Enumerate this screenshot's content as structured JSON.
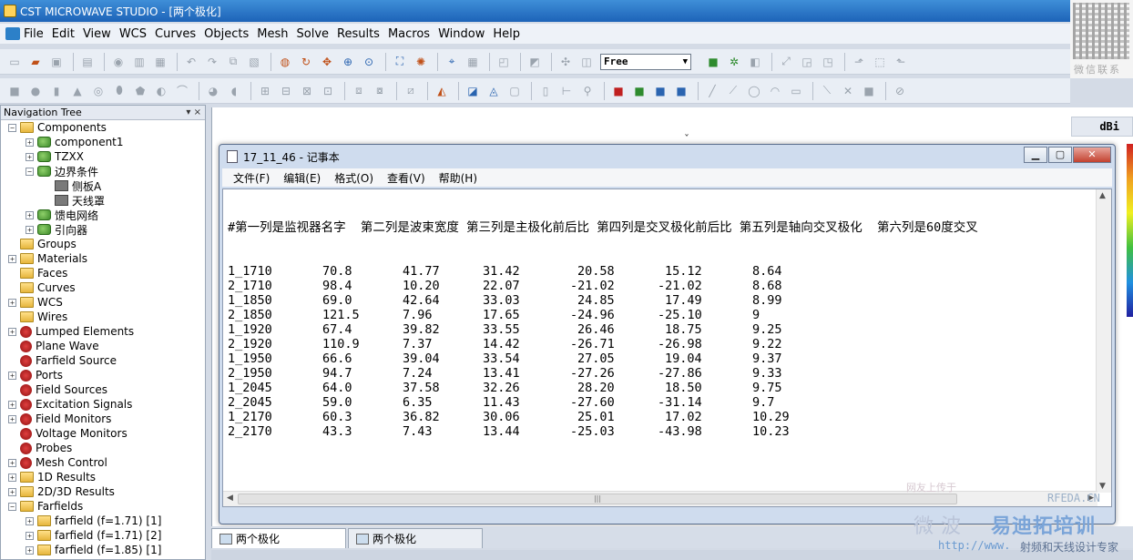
{
  "app": {
    "title": "CST MICROWAVE STUDIO - [两个极化]"
  },
  "menu": [
    "File",
    "Edit",
    "View",
    "WCS",
    "Curves",
    "Objects",
    "Mesh",
    "Solve",
    "Results",
    "Macros",
    "Window",
    "Help"
  ],
  "toolbar": {
    "mode_select": "Free"
  },
  "qr": {
    "caption": "微信联系"
  },
  "nav": {
    "title": "Navigation Tree",
    "header_icons": "▾ ×",
    "items": [
      {
        "label": "Components",
        "expander": "−",
        "icon": "folder",
        "indent": 0
      },
      {
        "label": "component1",
        "expander": "+",
        "icon": "comp",
        "indent": 1
      },
      {
        "label": "TZXX",
        "expander": "+",
        "icon": "comp",
        "indent": 1
      },
      {
        "label": "边界条件",
        "expander": "−",
        "icon": "comp",
        "indent": 1
      },
      {
        "label": "侧板A",
        "expander": "",
        "icon": "leaf",
        "indent": 2
      },
      {
        "label": "天线罩",
        "expander": "",
        "icon": "leaf",
        "indent": 2
      },
      {
        "label": "馈电网络",
        "expander": "+",
        "icon": "comp",
        "indent": 1
      },
      {
        "label": "引向器",
        "expander": "+",
        "icon": "comp",
        "indent": 1
      },
      {
        "label": "Groups",
        "expander": "",
        "icon": "folder",
        "indent": 0
      },
      {
        "label": "Materials",
        "expander": "+",
        "icon": "folder",
        "indent": 0
      },
      {
        "label": "Faces",
        "expander": "",
        "icon": "folder",
        "indent": 0
      },
      {
        "label": "Curves",
        "expander": "",
        "icon": "folder",
        "indent": 0
      },
      {
        "label": "WCS",
        "expander": "+",
        "icon": "folder",
        "indent": 0
      },
      {
        "label": "Wires",
        "expander": "",
        "icon": "folder",
        "indent": 0
      },
      {
        "label": "Lumped Elements",
        "expander": "+",
        "icon": "port",
        "indent": 0
      },
      {
        "label": "Plane Wave",
        "expander": "",
        "icon": "port",
        "indent": 0
      },
      {
        "label": "Farfield Source",
        "expander": "",
        "icon": "port",
        "indent": 0
      },
      {
        "label": "Ports",
        "expander": "+",
        "icon": "port",
        "indent": 0
      },
      {
        "label": "Field Sources",
        "expander": "",
        "icon": "port",
        "indent": 0
      },
      {
        "label": "Excitation Signals",
        "expander": "+",
        "icon": "port",
        "indent": 0
      },
      {
        "label": "Field Monitors",
        "expander": "+",
        "icon": "port",
        "indent": 0
      },
      {
        "label": "Voltage Monitors",
        "expander": "",
        "icon": "port",
        "indent": 0
      },
      {
        "label": "Probes",
        "expander": "",
        "icon": "port",
        "indent": 0
      },
      {
        "label": "Mesh Control",
        "expander": "+",
        "icon": "port",
        "indent": 0
      },
      {
        "label": "1D Results",
        "expander": "+",
        "icon": "folder",
        "indent": 0
      },
      {
        "label": "2D/3D Results",
        "expander": "+",
        "icon": "folder",
        "indent": 0
      },
      {
        "label": "Farfields",
        "expander": "−",
        "icon": "folder",
        "indent": 0
      },
      {
        "label": "farfield (f=1.71) [1]",
        "expander": "+",
        "icon": "folder",
        "indent": 1
      },
      {
        "label": "farfield (f=1.71) [2]",
        "expander": "+",
        "icon": "folder",
        "indent": 1
      },
      {
        "label": "farfield (f=1.85) [1]",
        "expander": "+",
        "icon": "folder",
        "indent": 1
      }
    ]
  },
  "view": {
    "units": "dBi"
  },
  "notepad": {
    "title": "17_11_46 - 记事本",
    "menu": [
      "文件(F)",
      "编辑(E)",
      "格式(O)",
      "查看(V)",
      "帮助(H)"
    ],
    "header_line": "#第一列是监视器名字  第二列是波束宽度 第三列是主极化前后比 第四列是交叉极化前后比 第五列是轴向交叉极化  第六列是60度交叉",
    "rows": [
      [
        "1_1710",
        "70.8",
        "41.77",
        "31.42",
        "20.58",
        "15.12",
        "8.64"
      ],
      [
        "2_1710",
        "98.4",
        "10.20",
        "22.07",
        "-21.02",
        "-21.02",
        "8.68"
      ],
      [
        "1_1850",
        "69.0",
        "42.64",
        "33.03",
        "24.85",
        "17.49",
        "8.99"
      ],
      [
        "2_1850",
        "121.5",
        "7.96",
        "17.65",
        "-24.96",
        "-25.10",
        "9"
      ],
      [
        "1_1920",
        "67.4",
        "39.82",
        "33.55",
        "26.46",
        "18.75",
        "9.25"
      ],
      [
        "2_1920",
        "110.9",
        "7.37",
        "14.42",
        "-26.71",
        "-26.98",
        "9.22"
      ],
      [
        "1_1950",
        "66.6",
        "39.04",
        "33.54",
        "27.05",
        "19.04",
        "9.37"
      ],
      [
        "2_1950",
        "94.7",
        "7.24",
        "13.41",
        "-27.26",
        "-27.86",
        "9.33"
      ],
      [
        "1_2045",
        "64.0",
        "37.58",
        "32.26",
        "28.20",
        "18.50",
        "9.75"
      ],
      [
        "2_2045",
        "59.0",
        "6.35",
        "11.43",
        "-27.60",
        "-31.14",
        "9.7"
      ],
      [
        "1_2170",
        "60.3",
        "36.82",
        "30.06",
        "25.01",
        "17.02",
        "10.29"
      ],
      [
        "2_2170",
        "43.3",
        "7.43",
        "13.44",
        "-25.03",
        "-43.98",
        "10.23"
      ]
    ]
  },
  "tabs": [
    {
      "label": "两个极化",
      "active": true
    },
    {
      "label": "两个极化",
      "active": false
    }
  ],
  "watermark": {
    "line1": "网友上传于",
    "site": "RFEDA.CN",
    "brand_a": "微波",
    "brand_b": "易迪拓培训",
    "url": "http://www.",
    "slogan": "射频和天线设计专家"
  }
}
